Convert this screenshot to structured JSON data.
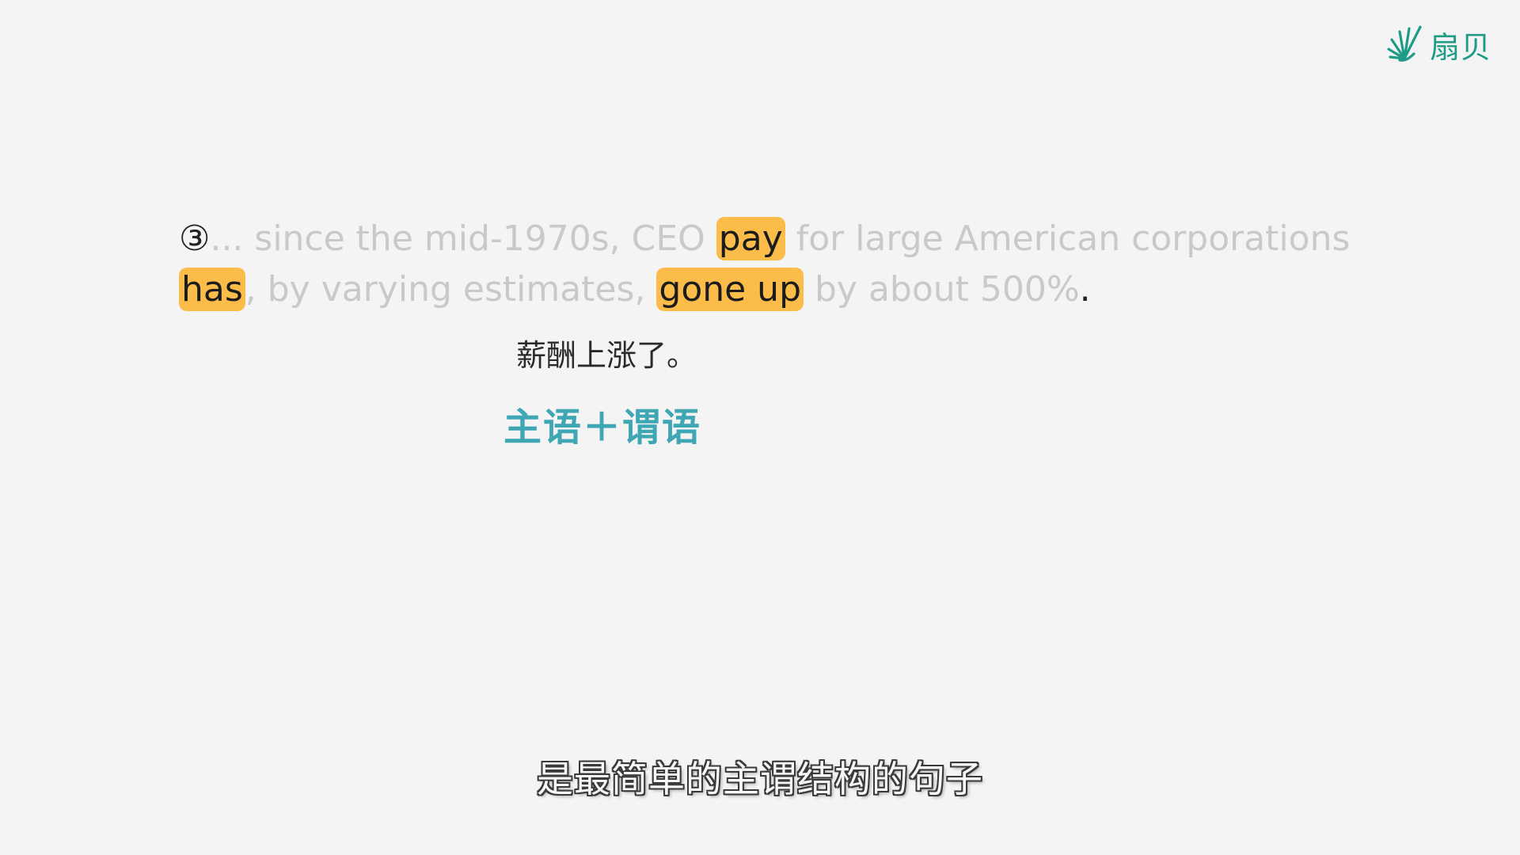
{
  "logo": {
    "text": "扇贝",
    "color": "#1f9b86"
  },
  "sentence": {
    "number": "③",
    "parts": {
      "p1": "... since the mid-1970s, CEO ",
      "hl1": "pay",
      "p2": " for large American corporations ",
      "hl2": "has",
      "p3": ", by varying estimates, ",
      "hl3": "gone up",
      "p4": " by about 500%",
      "end": "."
    },
    "highlight_color": "#fbbc4a",
    "faded_color": "#c9c9c9"
  },
  "gloss": "薪酬上涨了。",
  "structure": "主语＋谓语",
  "structure_color": "#3fa6b4",
  "subtitle": "是最简单的主谓结构的句子"
}
